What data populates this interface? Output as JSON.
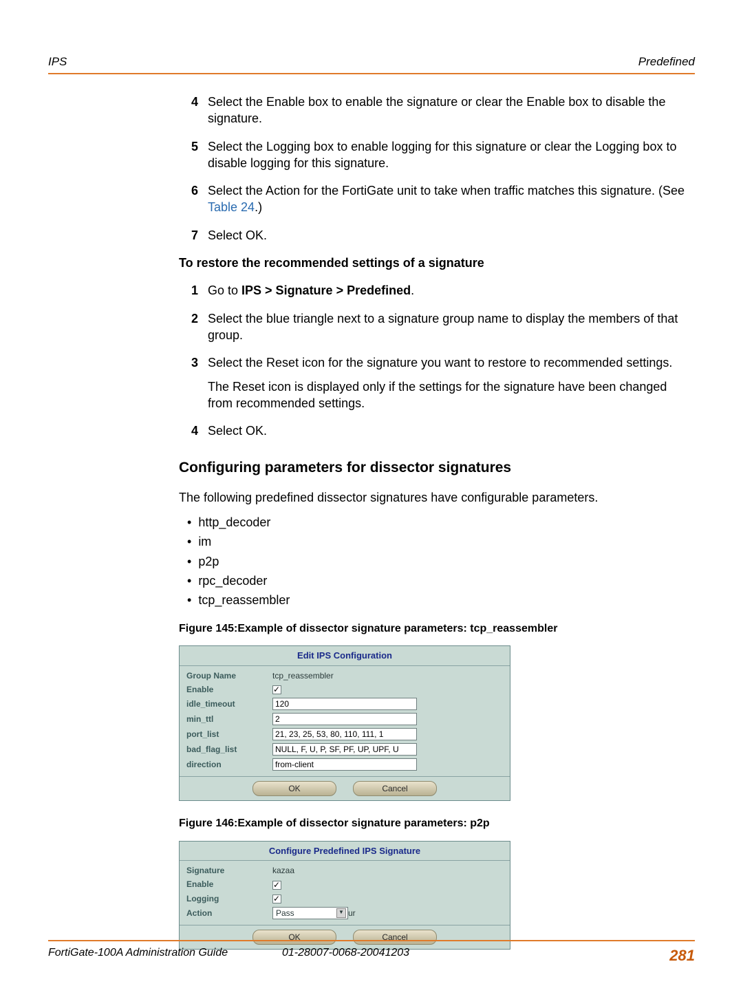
{
  "header": {
    "left": "IPS",
    "right": "Predefined"
  },
  "steps1": [
    {
      "num": "4",
      "text": "Select the Enable box to enable the signature or clear the Enable box to disable the signature."
    },
    {
      "num": "5",
      "text": "Select the Logging box to enable logging for this signature or clear the Logging box to disable logging for this signature."
    },
    {
      "num": "6",
      "text_pre": "Select the Action for the FortiGate unit to take when traffic matches this signature. (See ",
      "link": "Table 24",
      "text_post": ".)"
    },
    {
      "num": "7",
      "text": "Select OK."
    }
  ],
  "subhead1": "To restore the recommended settings of a signature",
  "steps2": [
    {
      "num": "1",
      "bold_pre": "Go to ",
      "bold_mid": "IPS > Signature > Predefined",
      "bold_post": "."
    },
    {
      "num": "2",
      "text": "Select the blue triangle next to a signature group name to display the members of that group."
    },
    {
      "num": "3",
      "text": "Select the Reset icon for the signature you want to restore to recommended settings.",
      "extra": "The Reset icon is displayed only if the settings for the signature have been changed from recommended settings."
    },
    {
      "num": "4",
      "text": "Select OK."
    }
  ],
  "section_head": "Configuring parameters for dissector signatures",
  "section_para": "The following predefined dissector signatures have configurable parameters.",
  "bullets": [
    "http_decoder",
    "im",
    "p2p",
    "rpc_decoder",
    "tcp_reassembler"
  ],
  "fig1": {
    "caption": "Figure 145:Example of dissector signature parameters: tcp_reassembler",
    "title": "Edit IPS Configuration",
    "rows": {
      "group_name_lbl": "Group Name",
      "group_name_val": "tcp_reassembler",
      "enable_lbl": "Enable",
      "enable_checked": true,
      "idle_lbl": "idle_timeout",
      "idle_val": "120",
      "min_lbl": "min_ttl",
      "min_val": "2",
      "port_lbl": "port_list",
      "port_val": "21, 23, 25, 53, 80, 110, 111, 1",
      "flag_lbl": "bad_flag_list",
      "flag_val": "NULL, F, U, P, SF, PF, UP, UPF, U",
      "dir_lbl": "direction",
      "dir_val": "from-client"
    },
    "ok": "OK",
    "cancel": "Cancel"
  },
  "fig2": {
    "caption": "Figure 146:Example of dissector signature parameters: p2p",
    "title": "Configure Predefined IPS Signature",
    "rows": {
      "sig_lbl": "Signature",
      "sig_val": "kazaa",
      "enable_lbl": "Enable",
      "enable_checked": true,
      "log_lbl": "Logging",
      "log_checked": true,
      "action_lbl": "Action",
      "action_val": "Pass"
    },
    "ok": "OK",
    "cancel": "Cancel"
  },
  "footer": {
    "left": "FortiGate-100A Administration Guide",
    "mid": "01-28007-0068-20041203",
    "right": "281"
  }
}
